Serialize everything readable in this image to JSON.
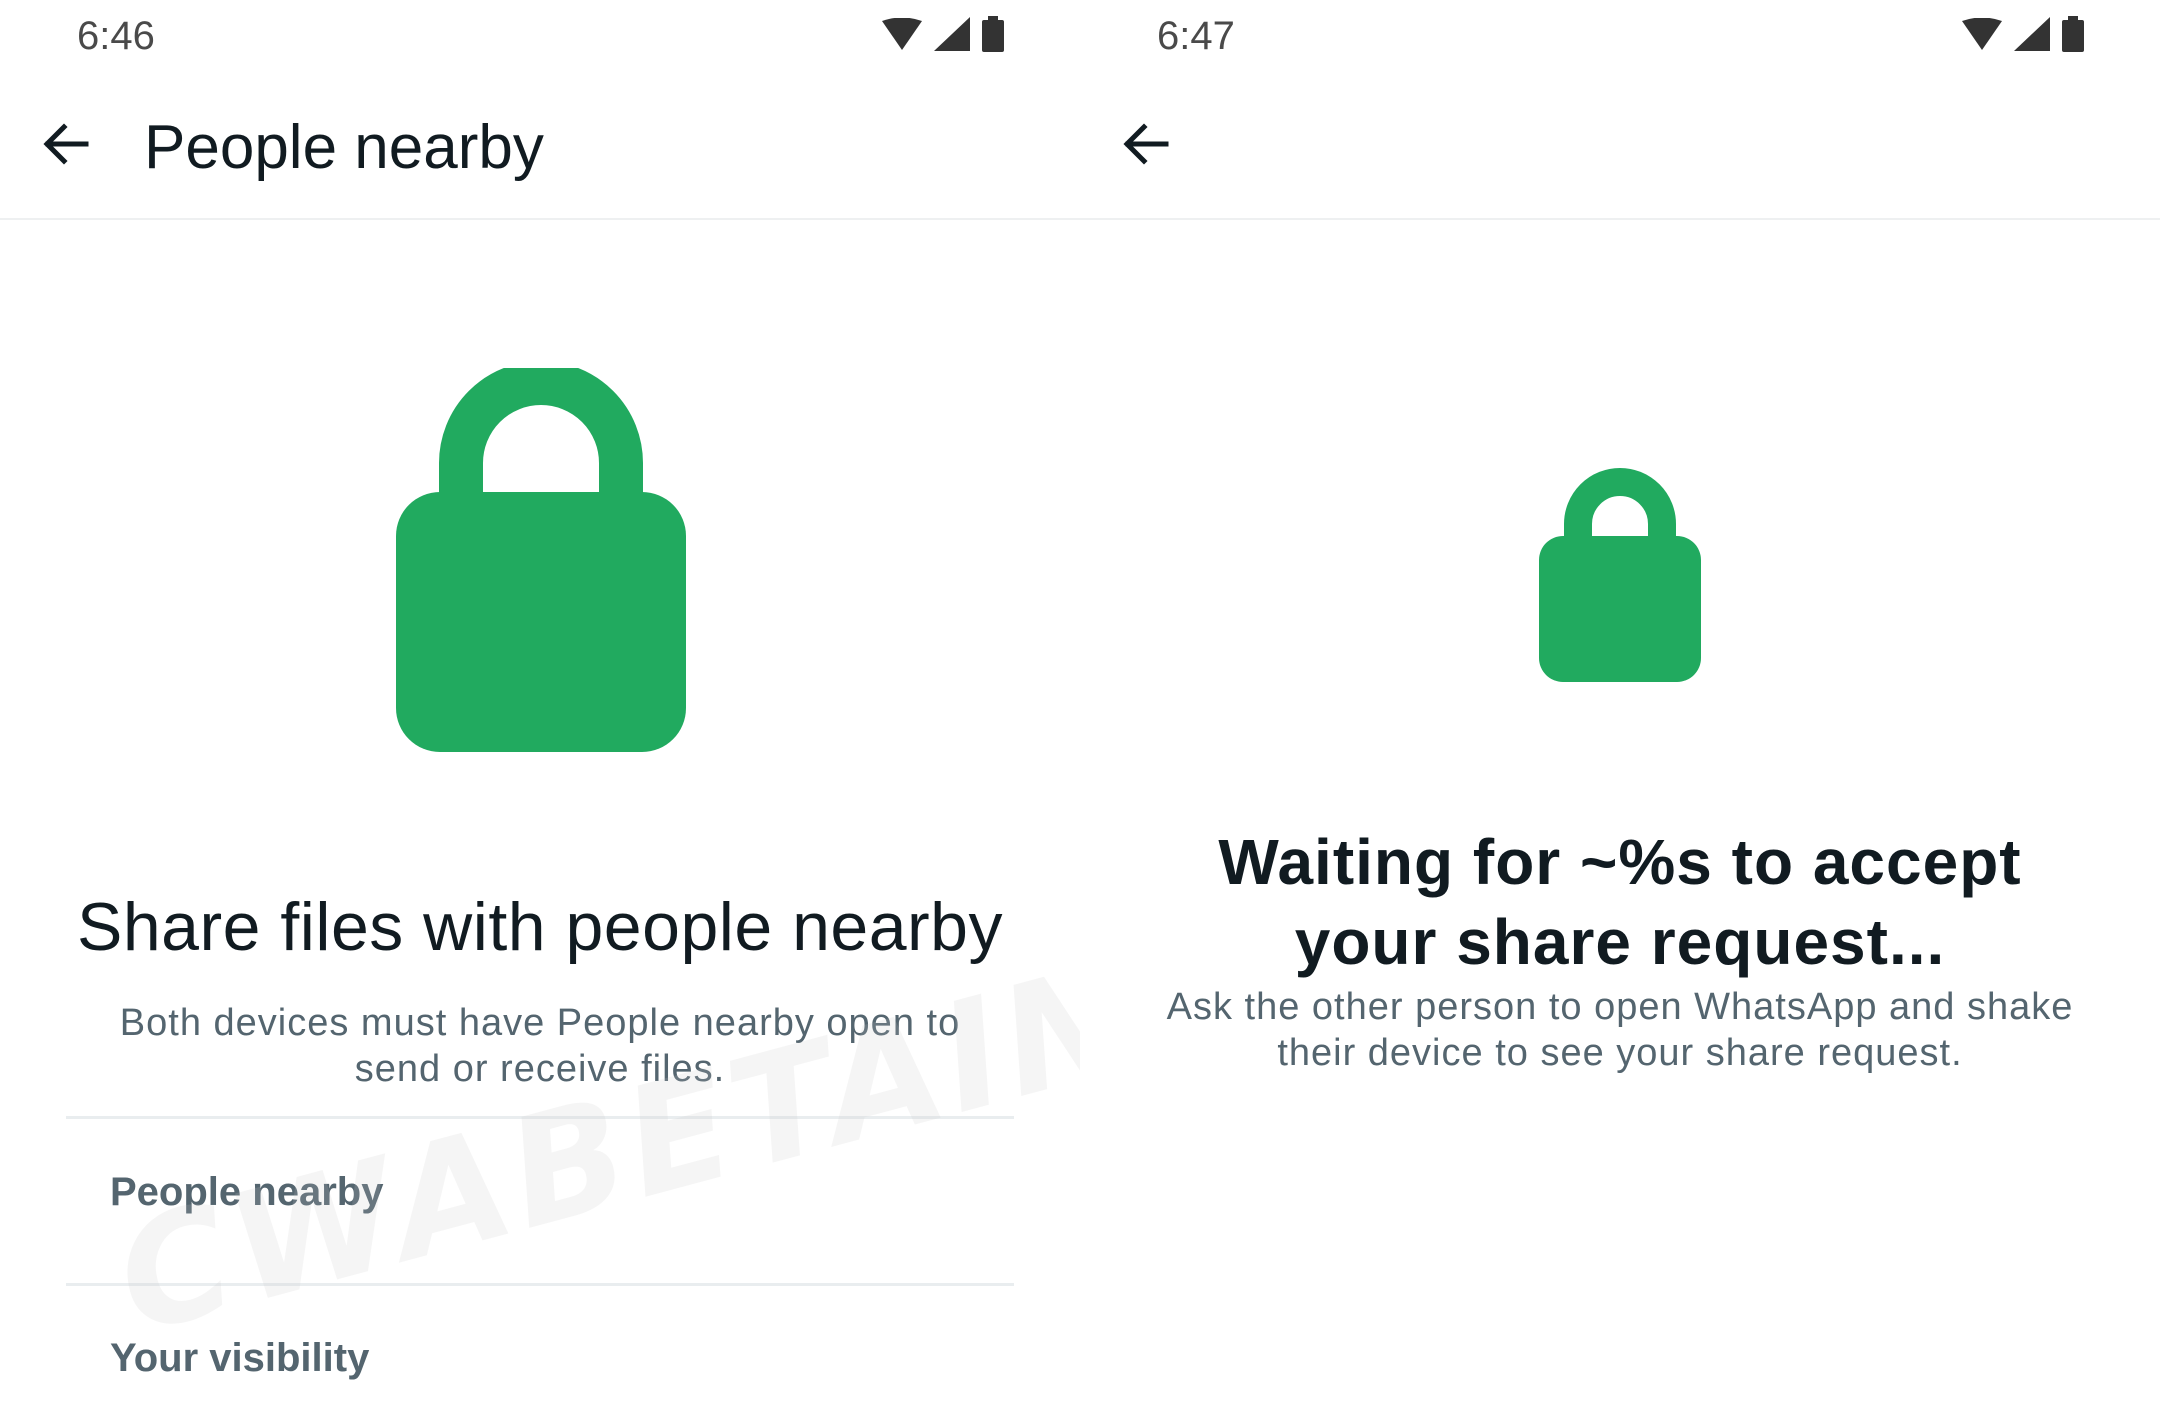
{
  "left_screen": {
    "status_time": "6:46",
    "title": "People nearby",
    "heading": "Share files with people nearby",
    "description": "Both devices must have People nearby open to send or receive files.",
    "sections": [
      {
        "label": "People nearby"
      },
      {
        "label": "Your visibility"
      }
    ]
  },
  "right_screen": {
    "status_time": "6:47",
    "heading": "Waiting for ~%s to accept your share request...",
    "description": "Ask the other person to open WhatsApp and shake their device to see your share request."
  },
  "watermark": "CWABETAINFO",
  "colors": {
    "accent_green": "#21AA5F",
    "text_primary": "#111B21",
    "text_secondary": "#54656F"
  },
  "icons": [
    "back-arrow-icon",
    "lock-icon",
    "wifi-icon",
    "cellular-signal-icon",
    "battery-icon"
  ]
}
